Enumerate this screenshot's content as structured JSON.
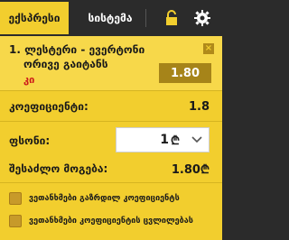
{
  "tabs": {
    "active": "ექსპრესი",
    "second": "სისტემა"
  },
  "icons": {
    "lock": "lock-icon",
    "settings": "gear-icon",
    "close": "close-icon",
    "chevron": "chevron-down-icon"
  },
  "bet": {
    "number": "1.",
    "title_line1": "ლესტერი - ევერტონი",
    "title_line2": "ორივე გაიტანს",
    "market": "კი",
    "odds": "1.80",
    "close": "×"
  },
  "coefficient": {
    "label": "კოეფიციენტი:",
    "value": "1.8"
  },
  "stake": {
    "label": "ფსონი:",
    "value": "1",
    "currency": "₾"
  },
  "winnings": {
    "label": "შესაძლო მოგება:",
    "value": "1.80₾"
  },
  "options": [
    {
      "label": "ვეთანხმები გაზრდილ კოეფიციენტს"
    },
    {
      "label": "ვეთანხმები კოეფიციენტის ცვლილებას"
    }
  ],
  "colors": {
    "accent": "#f2ce2e",
    "dark": "#2b2b2b",
    "market": "#cc1a1a",
    "odds_bg": "#a68419"
  }
}
